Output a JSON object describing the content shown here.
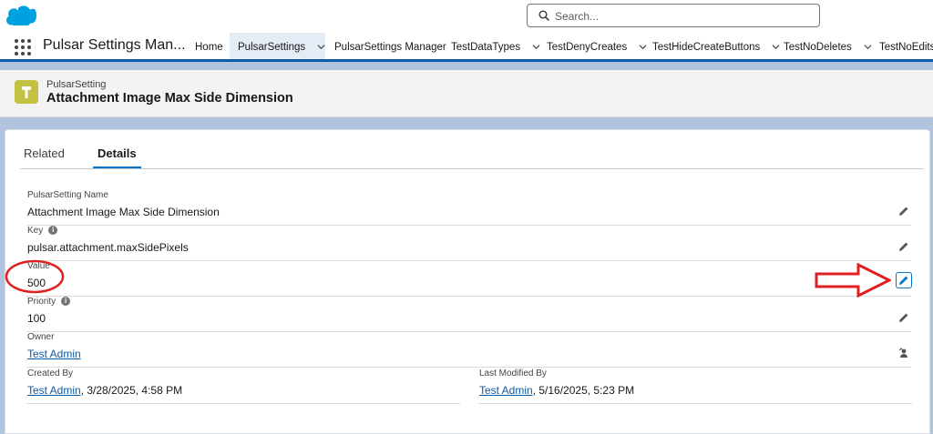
{
  "header": {
    "search_placeholder": "Search...",
    "icons": {
      "logo": "salesforce-cloud-icon",
      "search": "search-icon"
    }
  },
  "nav": {
    "app_name": "Pulsar Settings Man...",
    "items": [
      {
        "label": "Home"
      },
      {
        "label": "PulsarSettings",
        "active": true,
        "dropdown": true
      },
      {
        "label": "PulsarSettings Manager"
      },
      {
        "label": "TestDataTypes",
        "dropdown": true
      },
      {
        "label": "TestDenyCreates",
        "dropdown": true
      },
      {
        "label": "TestHideCreateButtons",
        "dropdown": true
      },
      {
        "label": "TestNoDeletes",
        "dropdown": true
      },
      {
        "label": "TestNoEdits"
      }
    ]
  },
  "record": {
    "type": "PulsarSetting",
    "title": "Attachment Image Max Side Dimension",
    "icon": "hammer-icon",
    "icon_color": "#c2c144"
  },
  "tabs": [
    {
      "label": "Related"
    },
    {
      "label": "Details",
      "active": true
    }
  ],
  "fields": {
    "name": {
      "label": "PulsarSetting Name",
      "value": "Attachment Image Max Side Dimension"
    },
    "key": {
      "label": "Key",
      "value": "pulsar.attachment.maxSidePixels"
    },
    "value": {
      "label": "Value",
      "value": "500"
    },
    "priority": {
      "label": "Priority",
      "value": "100"
    },
    "owner": {
      "label": "Owner",
      "value": "Test Admin"
    },
    "created_by": {
      "label": "Created By",
      "user": "Test Admin",
      "date": ", 3/28/2025, 4:58 PM"
    },
    "last_modified_by": {
      "label": "Last Modified By",
      "user": "Test Admin",
      "date": ", 5/16/2025, 5:23 PM"
    }
  },
  "colors": {
    "brand": "#0b5cab",
    "link": "#0b5cab",
    "annotation": "#e02020"
  }
}
